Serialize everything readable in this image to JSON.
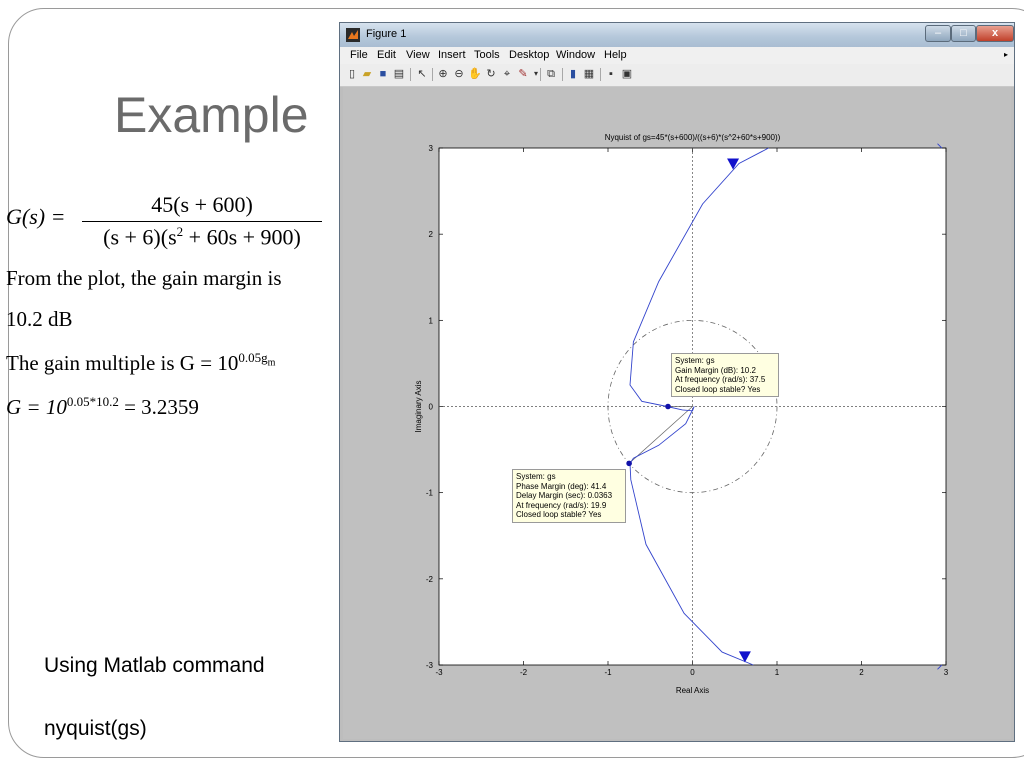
{
  "slide": {
    "title": "Example",
    "formula_lhs": "G(s) =",
    "formula_num": "45(s + 600)",
    "formula_den_a": "(s + 6)(s",
    "formula_den_exp": "2",
    "formula_den_b": " + 60s + 900)",
    "line1": "From the plot, the gain margin is",
    "line2": "10.2 dB",
    "line3_text": "The gain multiple is G = 10",
    "line3_exp": "0.05g",
    "line3_sub": "m",
    "line4_base": "G = 10",
    "line4_exp": "0.05*10.2",
    "line4_result": " = 3.2359",
    "cmd_label": "Using Matlab command",
    "cmd": "nyquist(gs)"
  },
  "window": {
    "title": "Figure 1",
    "minimize": "–",
    "maximize": "□",
    "close": "x",
    "menu": [
      "File",
      "Edit",
      "View",
      "Insert",
      "Tools",
      "Desktop",
      "Window",
      "Help"
    ],
    "toolbar_icons": [
      "new-figure-icon",
      "open-file-icon",
      "save-icon",
      "print-icon",
      "pointer-icon",
      "zoom-in-icon",
      "zoom-out-icon",
      "pan-icon",
      "rotate-icon",
      "data-cursor-icon",
      "brush-icon",
      "link-plot-icon",
      "colorbar-icon",
      "legend-icon",
      "hide-plot-tools-icon",
      "show-plot-tools-icon"
    ]
  },
  "datatips": {
    "gain": [
      "System: gs",
      "Gain Margin (dB): 10.2",
      "At frequency (rad/s): 37.5",
      "Closed loop stable? Yes"
    ],
    "phase": [
      "System: gs",
      "Phase Margin (deg): 41.4",
      "Delay Margin (sec): 0.0363",
      "At frequency (rad/s): 19.9",
      "Closed loop stable? Yes"
    ]
  },
  "chart_data": {
    "type": "line",
    "title": "Nyquist of gs=45*(s+600)/((s+6)*(s^2+60*s+900))",
    "xlabel": "Real Axis",
    "ylabel": "Imaginary Axis",
    "xlim": [
      -3,
      3
    ],
    "ylim": [
      -3,
      3
    ],
    "xticks": [
      -3,
      -2,
      -1,
      0,
      1,
      2,
      3
    ],
    "yticks": [
      -3,
      -2,
      -1,
      0,
      1,
      2,
      3
    ],
    "unit_circle": true,
    "series": [
      {
        "points": [
          [
            0.9,
            3.0
          ],
          [
            0.55,
            2.82
          ],
          [
            0.12,
            2.35
          ],
          [
            -0.4,
            1.45
          ],
          [
            -0.7,
            0.75
          ],
          [
            -0.74,
            0.25
          ],
          [
            -0.6,
            0.06
          ],
          [
            -0.3,
            0.0
          ],
          [
            -0.12,
            -0.04
          ],
          [
            0.0,
            -0.05
          ],
          [
            0.02,
            0.0
          ],
          [
            -0.08,
            -0.2
          ],
          [
            -0.4,
            -0.45
          ],
          [
            -0.7,
            -0.6
          ],
          [
            -0.74,
            -0.66
          ],
          [
            -0.73,
            -0.85
          ],
          [
            -0.55,
            -1.6
          ],
          [
            -0.1,
            -2.4
          ],
          [
            0.35,
            -2.85
          ],
          [
            0.72,
            -3.0
          ]
        ],
        "color": "#3344cc"
      },
      {
        "points": [
          [
            2.95,
            3.0
          ],
          [
            2.9,
            3.05
          ]
        ],
        "color": "#3344cc"
      },
      {
        "points": [
          [
            2.95,
            -3.0
          ],
          [
            2.9,
            -3.05
          ]
        ],
        "color": "#3344cc"
      }
    ],
    "arrows": [
      [
        0.48,
        2.82
      ],
      [
        0.62,
        -2.9
      ]
    ],
    "markers": [
      {
        "name": "gain-margin-marker",
        "x": -0.29,
        "y": 0.0
      },
      {
        "name": "phase-margin-marker",
        "x": -0.75,
        "y": -0.66
      }
    ]
  }
}
